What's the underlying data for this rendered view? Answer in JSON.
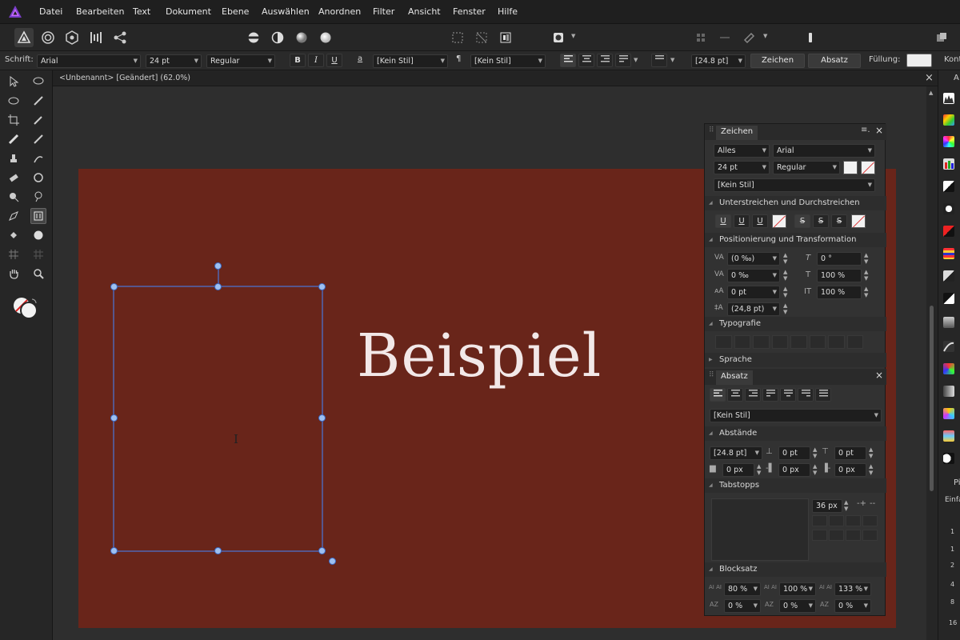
{
  "menu": [
    "Datei",
    "Bearbeiten",
    "Text",
    "Dokument",
    "Ebene",
    "Auswählen",
    "Anordnen",
    "Filter",
    "Ansicht",
    "Fenster",
    "Hilfe"
  ],
  "context_bar": {
    "font_label": "Schrift:",
    "font_family": "Arial",
    "font_size": "24 pt",
    "font_style": "Regular",
    "bold": "B",
    "italic": "I",
    "underline": "U",
    "char_style_icon": "a",
    "char_style": "[Kein Stil]",
    "para_style_icon": "¶",
    "para_style": "[Kein Stil]",
    "leading": "[24.8 pt]",
    "zeichen_button": "Zeichen",
    "absatz_button": "Absatz",
    "fill_label": "Füllung:",
    "kont_label": "Kont"
  },
  "document_tab": {
    "title": "<Unbenannt> [Geändert] (62.0%)",
    "close": "×"
  },
  "canvas": {
    "artboard_color": "#69251a",
    "sample_text": "Beispiel",
    "cursor": "I"
  },
  "zeichen_panel": {
    "tab": "Zeichen",
    "scope": "Alles",
    "font": "Arial",
    "size": "24 pt",
    "style": "Regular",
    "char_style": "[Kein Stil]",
    "sec_underline": "Unterstreichen und Durchstreichen",
    "underline_buttons": [
      "U",
      "U",
      "U"
    ],
    "strike_buttons": [
      "S",
      "S",
      "S"
    ],
    "sec_position": "Positionierung und Transformation",
    "tracking": "(0 ‰)",
    "skew": "0 °",
    "kerning": "0 ‰",
    "vscale": "100 %",
    "baseline": "0 pt",
    "hscale": "100 %",
    "leading": "(24,8 pt)",
    "sec_typo": "Typografie",
    "sec_lang": "Sprache"
  },
  "absatz_panel": {
    "tab": "Absatz",
    "style": "[Kein Stil]",
    "sec_spacing": "Abstände",
    "leading": "[24.8 pt]",
    "space_before": "0 pt",
    "space_after": "0 pt",
    "indent_first": "0 px",
    "indent_left": "0 px",
    "indent_right": "0 px",
    "sec_tabs": "Tabstopps",
    "tab_width": "36 px",
    "sec_justify": "Blocksatz",
    "word_min": "80 %",
    "word_desired": "100 %",
    "word_max": "133 %",
    "letter_min": "0 %",
    "letter_desired": "0 %",
    "letter_max": "0 %"
  },
  "right_strip": {
    "top_label": "A",
    "bottom_label": "Pi",
    "einfa": "Einfa",
    "numbers": [
      "1",
      "1",
      "2",
      "4",
      "8",
      "16"
    ]
  }
}
